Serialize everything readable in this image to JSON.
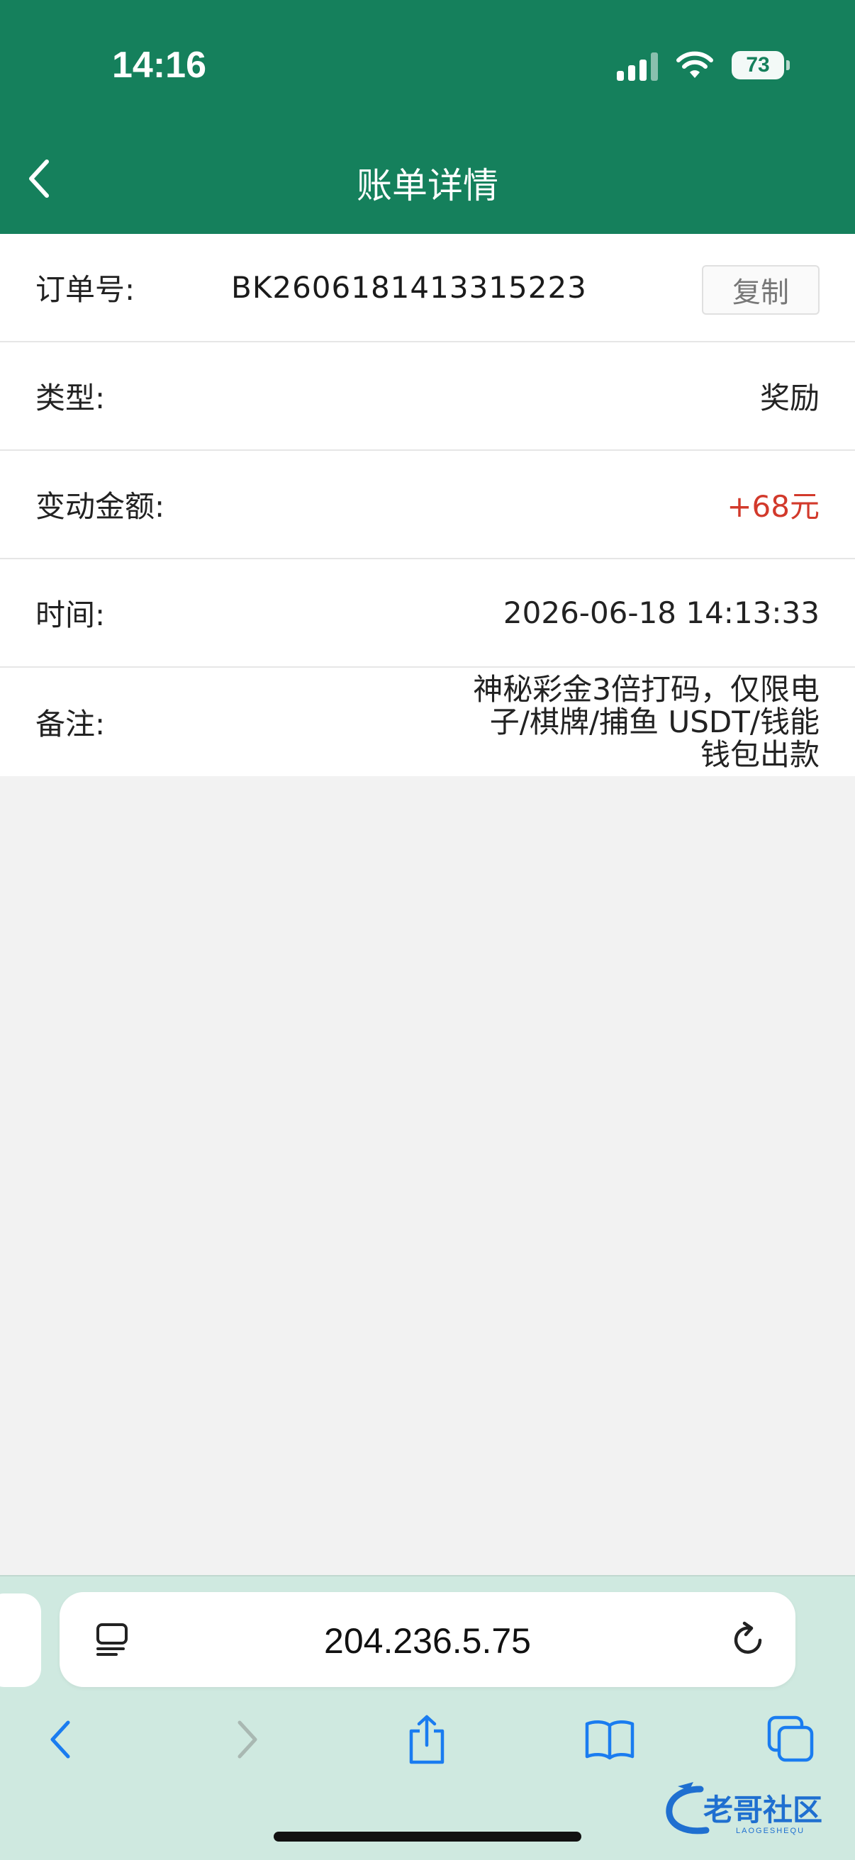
{
  "status_bar": {
    "time": "14:16",
    "battery": "73"
  },
  "nav": {
    "title": "账单详情"
  },
  "details": {
    "order": {
      "label": "订单号:",
      "value": "BK2606181413315223",
      "copy_label": "复制"
    },
    "type": {
      "label": "类型:",
      "value": "奖励"
    },
    "amount": {
      "label": "变动金额:",
      "value": "+68元",
      "color": "#d2392b"
    },
    "time": {
      "label": "时间:",
      "value": "2026-06-18 14:13:33"
    },
    "note": {
      "label": "备注:",
      "lines": [
        "神秘彩金3倍打码，仅限电",
        "子/棋牌/捕鱼 USDT/钱能",
        "钱包出款"
      ]
    }
  },
  "browser": {
    "url": "204.236.5.75"
  },
  "watermark": {
    "text": "老哥社区",
    "subtext": "LAOGESHEQU"
  },
  "colors": {
    "header": "#15805c",
    "browser_bar": "#cfe9e0",
    "accent_blue": "#1a7cf0"
  }
}
